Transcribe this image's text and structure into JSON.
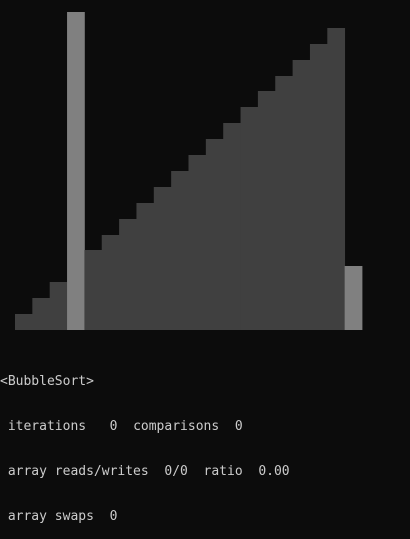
{
  "console": {
    "header": "<BubbleSort>",
    "line1": {
      "iterations_label": "iterations",
      "iterations_value": "0",
      "comparisons_label": "comparisons",
      "comparisons_value": "0"
    },
    "line2": {
      "reads_writes_label": "array reads/writes",
      "reads_writes_value": "0/0",
      "ratio_label": "ratio",
      "ratio_value": "0.00"
    },
    "line3": {
      "swaps_label": "array swaps",
      "swaps_value": "0"
    }
  },
  "visualization": {
    "bar_values": [
      1,
      2,
      3,
      20,
      5,
      6,
      7,
      8,
      9,
      10,
      11,
      12,
      13,
      14,
      15,
      16,
      17,
      18,
      19,
      4
    ],
    "highlighted_indices": [
      3,
      19
    ],
    "colors": {
      "background": "#0c0c0c",
      "bar": "#404040",
      "highlight": "#808080"
    }
  }
}
